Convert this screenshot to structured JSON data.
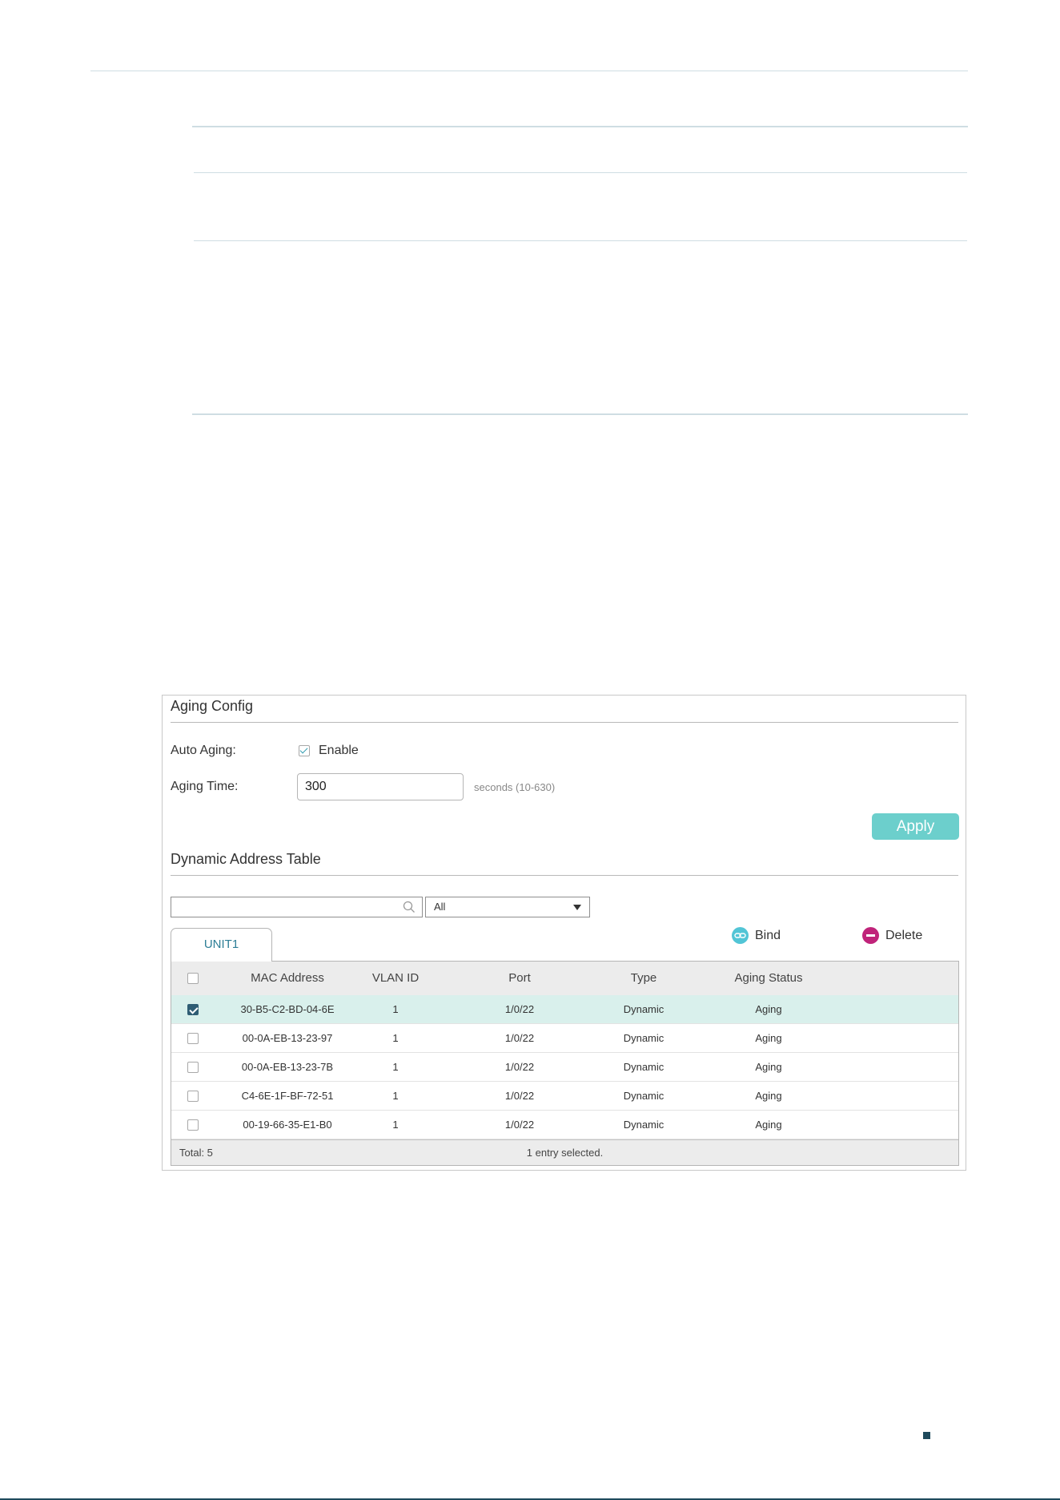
{
  "aging_config": {
    "title": "Aging Config",
    "auto_aging_label": "Auto Aging:",
    "enable_label": "Enable",
    "enable_checked": true,
    "aging_time_label": "Aging Time:",
    "aging_time_value": "300",
    "aging_time_hint": "seconds (10-630)",
    "apply_label": "Apply"
  },
  "dynamic_table": {
    "title": "Dynamic Address Table",
    "search_value": "",
    "filter_selected": "All",
    "tab_label": "UNIT1",
    "bind_label": "Bind",
    "delete_label": "Delete",
    "columns": [
      "MAC Address",
      "VLAN ID",
      "Port",
      "Type",
      "Aging Status"
    ],
    "rows": [
      {
        "mac": "30-B5-C2-BD-04-6E",
        "vlan": "1",
        "port": "1/0/22",
        "type": "Dynamic",
        "status": "Aging",
        "selected": true
      },
      {
        "mac": "00-0A-EB-13-23-97",
        "vlan": "1",
        "port": "1/0/22",
        "type": "Dynamic",
        "status": "Aging",
        "selected": false
      },
      {
        "mac": "00-0A-EB-13-23-7B",
        "vlan": "1",
        "port": "1/0/22",
        "type": "Dynamic",
        "status": "Aging",
        "selected": false
      },
      {
        "mac": "C4-6E-1F-BF-72-51",
        "vlan": "1",
        "port": "1/0/22",
        "type": "Dynamic",
        "status": "Aging",
        "selected": false
      },
      {
        "mac": "00-19-66-35-E1-B0",
        "vlan": "1",
        "port": "1/0/22",
        "type": "Dynamic",
        "status": "Aging",
        "selected": false
      }
    ],
    "total_label": "Total: 5",
    "selection_label": "1 entry selected."
  },
  "colors": {
    "accent": "#6ccfcc",
    "selected_row": "#d9f0ec",
    "bind_icon": "#52c5d6",
    "delete_icon": "#c0237a",
    "tab_text": "#2d7e96"
  },
  "icons": [
    "search-icon",
    "chevron-down-icon",
    "link-icon",
    "minus-circle-icon",
    "check-icon"
  ]
}
